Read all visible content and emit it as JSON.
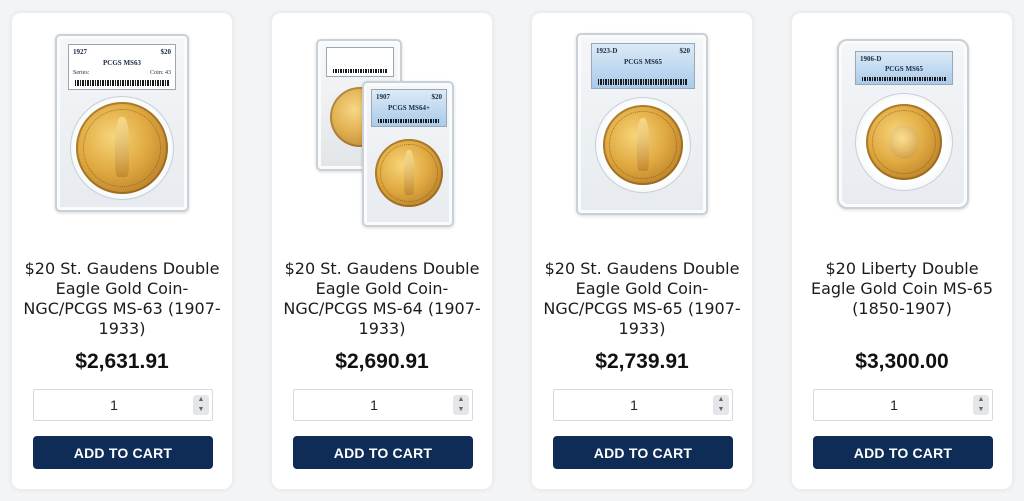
{
  "products": [
    {
      "title": "$20 St. Gaudens Double Eagle Gold Coin-NGC/PCGS MS-63 (1907-1933)",
      "price": "$2,631.91",
      "quantity": "1",
      "button_label": "ADD TO CART",
      "image": {
        "label_date": "1927",
        "label_denomination": "$20",
        "label_grade": "PCGS MS63",
        "label_series": "Series:",
        "label_coin": "Coin: 43"
      }
    },
    {
      "title": "$20 St. Gaudens Double Eagle Gold Coin-NGC/PCGS MS-64 (1907-1933)",
      "price": "$2,690.91",
      "quantity": "1",
      "button_label": "ADD TO CART",
      "image": {
        "label_date": "1907",
        "label_denomination": "$20",
        "label_grade": "PCGS MS64+"
      }
    },
    {
      "title": "$20 St. Gaudens Double Eagle Gold Coin-NGC/PCGS MS-65 (1907-1933)",
      "price": "$2,739.91",
      "quantity": "1",
      "button_label": "ADD TO CART",
      "image": {
        "label_date": "1923-D",
        "label_denomination": "$20",
        "label_grade": "PCGS MS65"
      }
    },
    {
      "title": "$20 Liberty Double Eagle Gold Coin MS-65 (1850-1907)",
      "price": "$3,300.00",
      "quantity": "1",
      "button_label": "ADD TO CART",
      "image": {
        "label_date": "1906-D",
        "label_grade": "PCGS MS65"
      }
    }
  ],
  "colors": {
    "button_bg": "#0f2c57",
    "button_text": "#ffffff",
    "card_bg": "#ffffff",
    "page_bg": "#f3f4f6"
  }
}
